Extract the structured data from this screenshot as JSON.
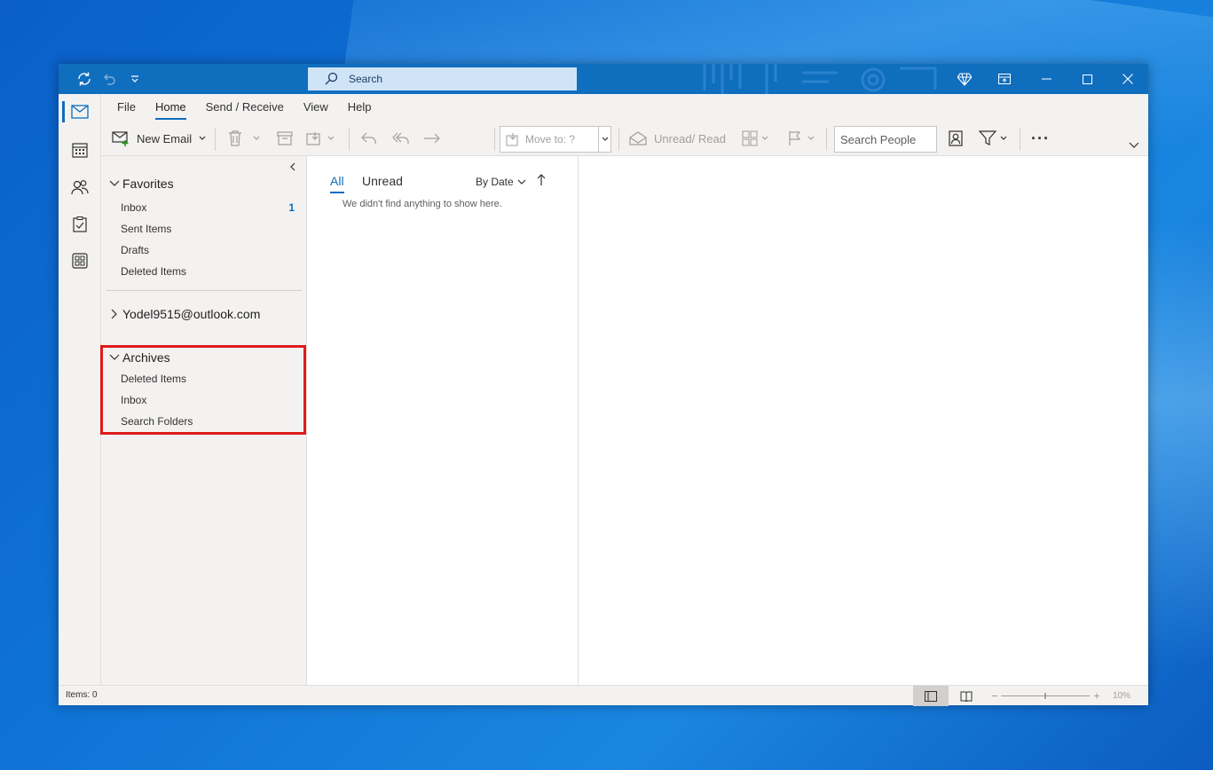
{
  "titlebar": {
    "search_placeholder": "Search"
  },
  "navrail": {
    "items": [
      "mail",
      "calendar",
      "people",
      "tasks",
      "apps"
    ]
  },
  "ribbon": {
    "tabs": [
      "File",
      "Home",
      "Send / Receive",
      "View",
      "Help"
    ],
    "active_tab": "Home",
    "new_email": "New Email",
    "move_to": "Move to: ?",
    "unread_read": "Unread/ Read",
    "search_people": "Search People",
    "more": "···"
  },
  "folders": {
    "favorites_header": "Favorites",
    "favorites": [
      {
        "label": "Inbox",
        "count": "1"
      },
      {
        "label": "Sent Items",
        "count": ""
      },
      {
        "label": "Drafts",
        "count": ""
      },
      {
        "label": "Deleted Items",
        "count": ""
      }
    ],
    "account": "Yodel9515@outlook.com",
    "archives_header": "Archives",
    "archives": [
      "Deleted Items",
      "Inbox",
      "Search Folders"
    ]
  },
  "message_list": {
    "filter_all": "All",
    "filter_unread": "Unread",
    "sort_by": "By Date",
    "empty_text": "We didn't find anything to show here."
  },
  "statusbar": {
    "items": "Items: 0",
    "zoom": "10%"
  },
  "colors": {
    "accent": "#0f6cbd",
    "titlebar": "#106ebe",
    "highlight": "#e01b1b"
  }
}
